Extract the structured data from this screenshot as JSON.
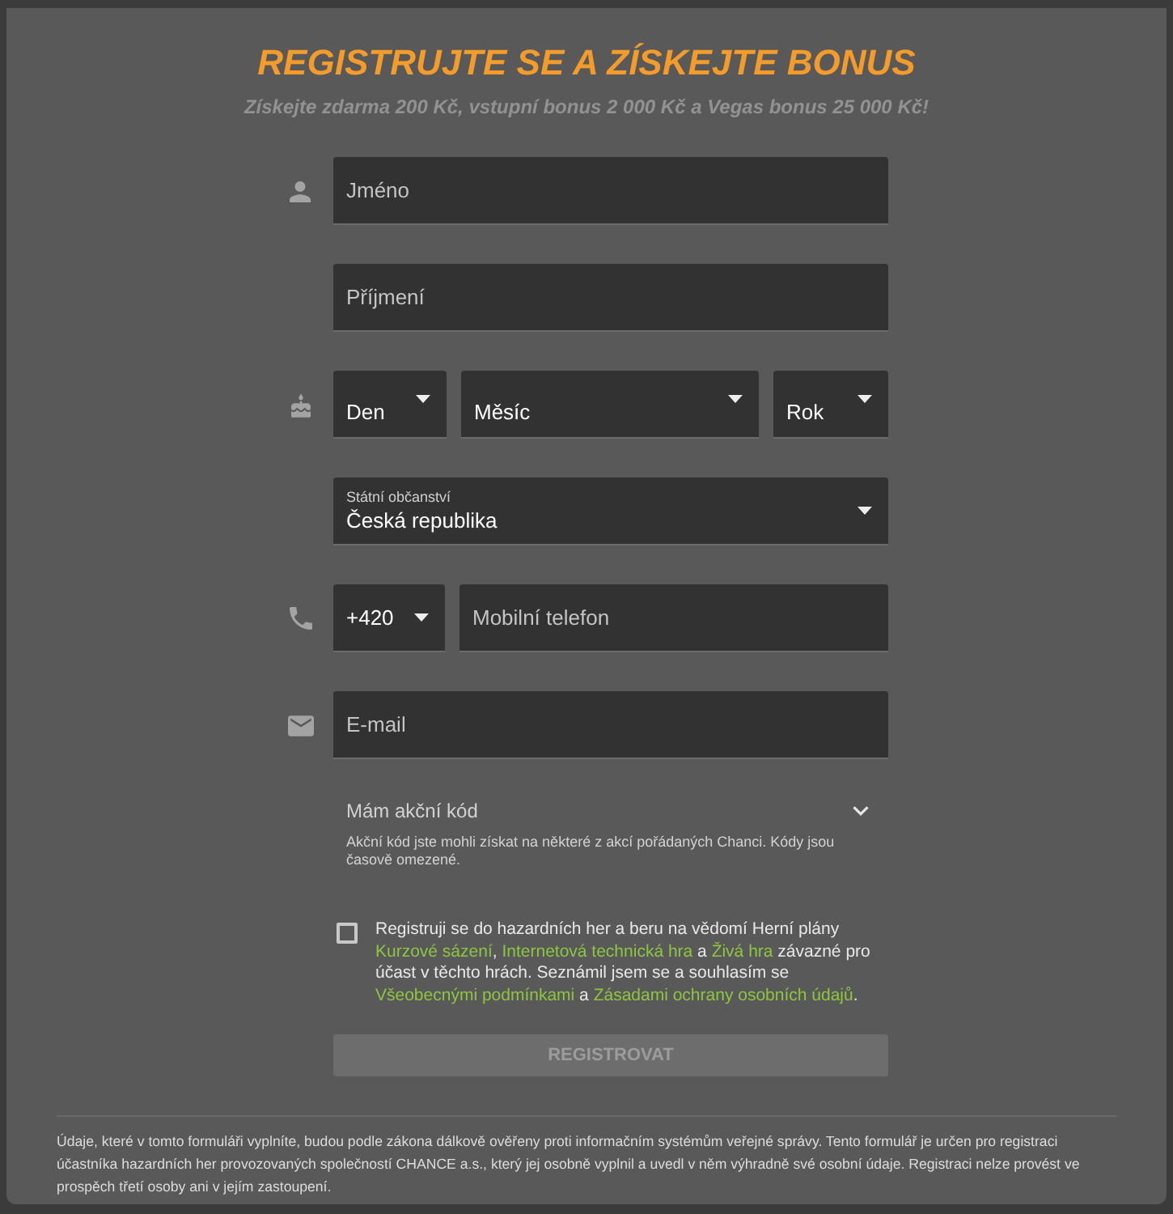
{
  "header": {
    "title": "REGISTRUJTE SE A ZÍSKEJTE BONUS",
    "subtitle": "Získejte zdarma 200 Kč, vstupní bonus 2 000 Kč a Vegas bonus 25 000 Kč!"
  },
  "form": {
    "first_name": {
      "placeholder": "Jméno"
    },
    "last_name": {
      "placeholder": "Příjmení"
    },
    "birth_date": {
      "day": "Den",
      "month": "Měsíc",
      "year": "Rok"
    },
    "citizenship": {
      "label": "Státní občanství",
      "value": "Česká republika"
    },
    "phone": {
      "prefix": "+420",
      "placeholder": "Mobilní telefon"
    },
    "email": {
      "placeholder": "E-mail"
    },
    "promo_code": {
      "label": "Mám akční kód",
      "expanded": false,
      "hint": "Akční kód jste mohli získat na některé z akcí pořádaných Chanci. Kódy jsou časově omezené."
    },
    "consent": {
      "checked": false,
      "segments": [
        {
          "kind": "text",
          "text": "Registruji se do hazardních her a beru na vědomí Herní plány "
        },
        {
          "kind": "link",
          "text": "Kurzové sázení"
        },
        {
          "kind": "text",
          "text": ", "
        },
        {
          "kind": "link",
          "text": "Internetová technická hra"
        },
        {
          "kind": "text",
          "text": " a "
        },
        {
          "kind": "link",
          "text": "Živá hra"
        },
        {
          "kind": "text",
          "text": " závazné pro účast v těchto hrách. Seznámil jsem se a souhlasím se "
        },
        {
          "kind": "link",
          "text": "Všeobecnými podmínkami"
        },
        {
          "kind": "text",
          "text": " a "
        },
        {
          "kind": "link",
          "text": "Zásadami ochrany osobních údajů"
        },
        {
          "kind": "text",
          "text": "."
        }
      ]
    },
    "submit": {
      "label": "REGISTROVAT",
      "disabled": true
    }
  },
  "footer_note": "Údaje, které v tomto formuláři vyplníte, budou podle zákona dálkově ověřeny proti informačním systémům veřejné správy. Tento formulář je určen pro registraci účastníka hazardních her provozovaných společností CHANCE a.s., který jej osobně vyplnil a uvedl v něm výhradně své osobní údaje. Registraci nelze provést ve prospěch třetí osoby ani v jejím zastoupení."
}
